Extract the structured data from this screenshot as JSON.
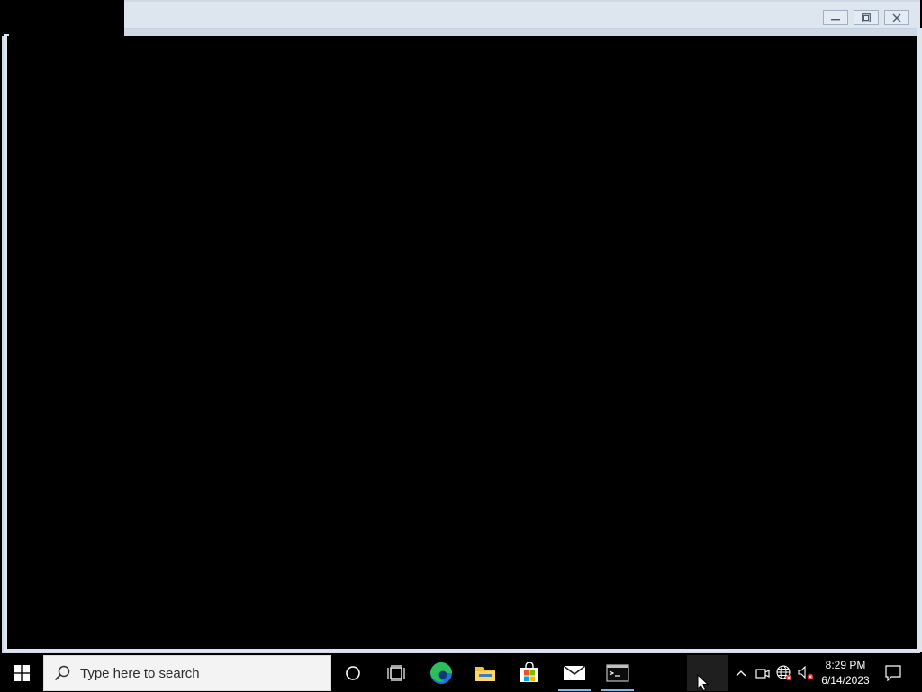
{
  "window": {
    "minimize_icon": "minimize-icon",
    "maximize_icon": "maximize-icon",
    "close_icon": "close-icon"
  },
  "taskbar": {
    "search_placeholder": "Type here to search",
    "pinned_apps": [
      "Microsoft Edge",
      "File Explorer",
      "Microsoft Store",
      "Mail",
      "Command Prompt"
    ],
    "clock": {
      "time": "8:29 PM",
      "date": "6/14/2023"
    }
  },
  "colors": {
    "desktop": "#000000",
    "window_frame": "#dde6ef",
    "active_indicator": "#76b9ed",
    "edge_blue": "#1976d2",
    "edge_green": "#2ebd5b",
    "folder_yellow": "#f5c33b"
  }
}
